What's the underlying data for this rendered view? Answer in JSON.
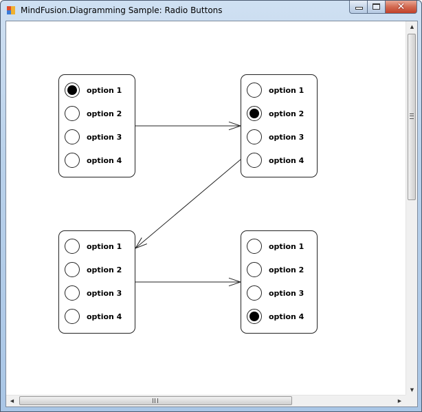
{
  "window": {
    "title": "MindFusion.Diagramming Sample: Radio Buttons",
    "icon": "app-icon",
    "buttons": {
      "minimize": "minimize-icon",
      "maximize": "maximize-icon",
      "close_glyph": "✕"
    }
  },
  "diagram": {
    "nodes": [
      {
        "id": "node-top-left",
        "options": [
          {
            "label": "option 1",
            "checked": true
          },
          {
            "label": "option 2",
            "checked": false
          },
          {
            "label": "option 3",
            "checked": false
          },
          {
            "label": "option 4",
            "checked": false
          }
        ]
      },
      {
        "id": "node-top-right",
        "options": [
          {
            "label": "option 1",
            "checked": false
          },
          {
            "label": "option 2",
            "checked": true
          },
          {
            "label": "option 3",
            "checked": false
          },
          {
            "label": "option 4",
            "checked": false
          }
        ]
      },
      {
        "id": "node-bottom-left",
        "options": [
          {
            "label": "option 1",
            "checked": false
          },
          {
            "label": "option 2",
            "checked": false
          },
          {
            "label": "option 3",
            "checked": false
          },
          {
            "label": "option 4",
            "checked": false
          }
        ]
      },
      {
        "id": "node-bottom-right",
        "options": [
          {
            "label": "option 1",
            "checked": false
          },
          {
            "label": "option 2",
            "checked": false
          },
          {
            "label": "option 3",
            "checked": false
          },
          {
            "label": "option 4",
            "checked": true
          }
        ]
      }
    ],
    "links": [
      {
        "from": "node-top-left",
        "to": "node-top-right"
      },
      {
        "from": "node-top-right",
        "to": "node-bottom-left"
      },
      {
        "from": "node-bottom-left",
        "to": "node-bottom-right"
      }
    ]
  },
  "scrollbars": {
    "vertical": {
      "up_arrow": "▲",
      "down_arrow": "▼"
    },
    "horizontal": {
      "left_arrow": "◀",
      "right_arrow": "▶"
    }
  }
}
